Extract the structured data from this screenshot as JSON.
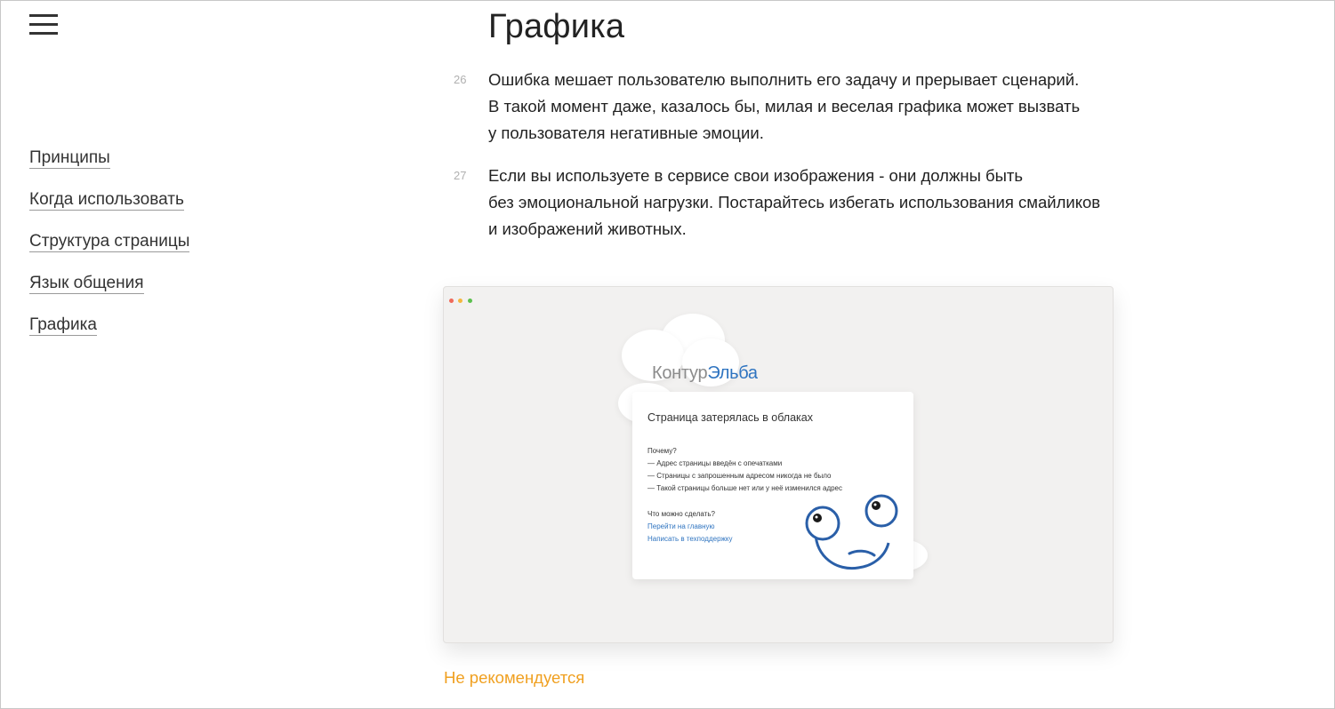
{
  "menu": {
    "icon": "hamburger-menu-icon"
  },
  "sidebar": {
    "items": [
      {
        "label": "Принципы"
      },
      {
        "label": "Когда использовать"
      },
      {
        "label": "Структура страницы"
      },
      {
        "label": "Язык общения"
      },
      {
        "label": "Графика"
      }
    ]
  },
  "page": {
    "title": "Графика"
  },
  "rules": [
    {
      "number": "26",
      "lines": [
        "Ошибка мешает пользователю выполнить его задачу и прерывает сценарий.",
        "В такой момент даже, казалось бы, милая и веселая графика может вызвать",
        "у пользователя негативные эмоции."
      ]
    },
    {
      "number": "27",
      "lines": [
        "Если вы используете в сервисе свои изображения - они должны быть",
        "без эмоциональной нагрузки. Постарайтесь избегать использования смайликов",
        "и изображений животных."
      ]
    }
  ],
  "example": {
    "window_dots": [
      "#f06a5a",
      "#f4b73f",
      "#5cc04e"
    ],
    "logo": {
      "part1": "Контур",
      "part2": "Эльба"
    },
    "card": {
      "title": "Страница затерялась в облаках",
      "why_heading": "Почему?",
      "reasons": [
        "— Адрес страницы введён с опечатками",
        "— Страницы с запрошенным адресом никогда не было",
        "— Такой страницы больше нет или у неё изменился адрес"
      ],
      "todo_heading": "Что можно сделать?",
      "links": [
        "Перейти на главную",
        "Написать в техподдержку"
      ]
    },
    "caption": "Не рекомендуется",
    "colors": {
      "brand_blue": "#2f74c0",
      "caption_orange": "#f0a020"
    }
  }
}
